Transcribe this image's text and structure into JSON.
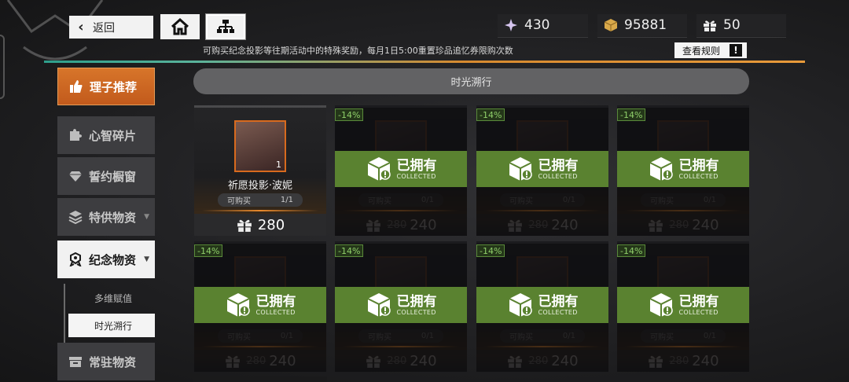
{
  "header": {
    "back_label": "返回",
    "home_icon": "home-icon",
    "map_icon": "sitemap-icon",
    "currencies": [
      {
        "icon": "crystal-icon",
        "value": "430"
      },
      {
        "icon": "cube-icon",
        "value": "95881"
      },
      {
        "icon": "gift-icon",
        "value": "50"
      }
    ],
    "notice": "可购买纪念投影等往期活动中的特殊奖励，每月1日5:00重置珍品追忆券限购次数",
    "rules_label": "查看规则",
    "rules_icon_text": "!"
  },
  "sidebar": {
    "items": [
      {
        "label": "理子推荐",
        "icon": "thumbs-up-icon"
      },
      {
        "label": "心智碎片",
        "icon": "puzzle-icon"
      },
      {
        "label": "誓约橱窗",
        "icon": "diamond-icon"
      },
      {
        "label": "特供物资",
        "icon": "layers-icon",
        "arrow": "▼"
      },
      {
        "label": "纪念物资",
        "icon": "badge-icon",
        "arrow": "▼"
      },
      {
        "label": "常驻物资",
        "icon": "box-icon"
      }
    ],
    "sub_items": [
      {
        "label": "多维赋值"
      },
      {
        "label": "时光溯行"
      }
    ]
  },
  "section_title": "时光溯行",
  "cards": [
    {
      "name": "祈愿投影·波妮",
      "quantity": "1",
      "limit_label": "可购买",
      "limit": "1/1",
      "price": "280",
      "owned": false
    },
    {
      "discount": "-14%",
      "limit_label": "可购买",
      "limit": "0/1",
      "old_price": "280",
      "price": "240",
      "owned": true
    },
    {
      "discount": "-14%",
      "limit_label": "可购买",
      "limit": "0/1",
      "old_price": "280",
      "price": "240",
      "owned": true
    },
    {
      "discount": "-14%",
      "limit_label": "可购买",
      "limit": "0/1",
      "old_price": "280",
      "price": "240",
      "owned": true
    },
    {
      "discount": "-14%",
      "limit_label": "可购买",
      "limit": "0/1",
      "old_price": "280",
      "price": "240",
      "owned": true
    },
    {
      "discount": "-14%",
      "limit_label": "可购买",
      "limit": "0/1",
      "old_price": "280",
      "price": "240",
      "owned": true
    },
    {
      "discount": "-14%",
      "limit_label": "可购买",
      "limit": "0/1",
      "old_price": "280",
      "price": "240",
      "owned": true
    },
    {
      "discount": "-14%",
      "limit_label": "可购买",
      "limit": "0/1",
      "old_price": "280",
      "price": "240",
      "owned": true
    }
  ],
  "owned_label": "已拥有",
  "owned_label_en": "COLLECTED",
  "colors": {
    "accent": "#d7752a",
    "owned": "#5a8230",
    "discount": "#8fcf6a"
  }
}
